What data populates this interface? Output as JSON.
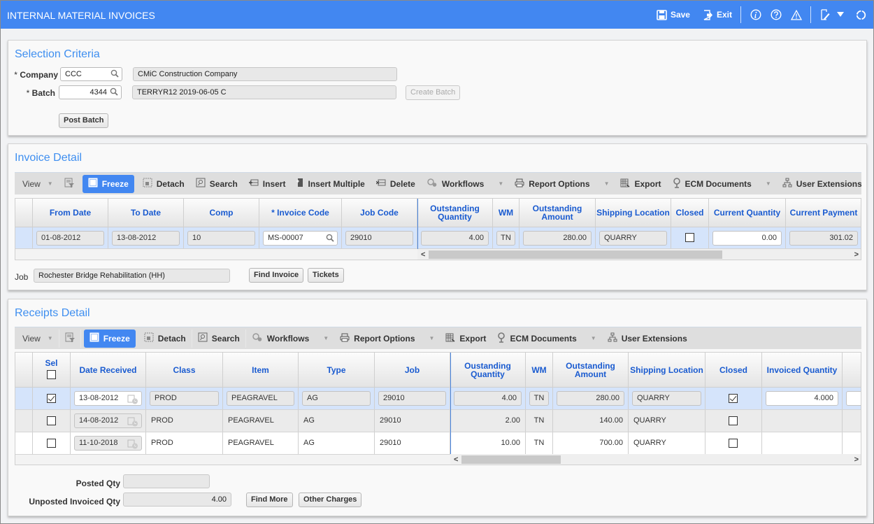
{
  "app": {
    "title": "INTERNAL MATERIAL INVOICES",
    "actions": {
      "save": "Save",
      "exit": "Exit"
    },
    "icons": [
      "save-icon",
      "exit-icon",
      "info-icon",
      "help-icon",
      "warning-icon",
      "edit-icon",
      "dropdown-icon",
      "refresh-icon"
    ],
    "accent": "#4287f1"
  },
  "selection": {
    "title": "Selection Criteria",
    "company_label": "Company",
    "company_value": "CCC",
    "company_name": "CMiC Construction Company",
    "batch_label": "Batch",
    "batch_value": "4344",
    "batch_desc": "TERRYR12 2019-06-05 C",
    "create_batch": "Create Batch",
    "post_batch": "Post Batch",
    "required_mark": "*"
  },
  "invoice": {
    "title": "Invoice Detail",
    "toolbar": {
      "view": "View",
      "freeze": "Freeze",
      "detach": "Detach",
      "search": "Search",
      "insert": "Insert",
      "insert_multiple": "Insert Multiple",
      "delete": "Delete",
      "workflows": "Workflows",
      "report_options": "Report Options",
      "export": "Export",
      "ecm": "ECM Documents",
      "user_ext": "User Extensions"
    },
    "columns": [
      "From Date",
      "To Date",
      "Comp",
      "* Invoice Code",
      "Job Code",
      "Outstanding Quantity",
      "WM",
      "Outstanding Amount",
      "Shipping Location",
      "Closed",
      "Current Quantity",
      "Current Payment"
    ],
    "row": {
      "from_date": "01-08-2012",
      "to_date": "13-08-2012",
      "comp": "10",
      "invoice_code": "MS-00007",
      "job_code": "29010",
      "out_qty": "4.00",
      "wm": "TN",
      "out_amt": "280.00",
      "ship_loc": "QUARRY",
      "closed": false,
      "cur_qty": "0.00",
      "cur_pay": "301.02"
    },
    "job_label": "Job",
    "job_value": "Rochester Bridge Rehabilitation (HH)",
    "find_invoice": "Find Invoice",
    "tickets": "Tickets"
  },
  "receipts": {
    "title": "Receipts Detail",
    "toolbar": {
      "view": "View",
      "freeze": "Freeze",
      "detach": "Detach",
      "search": "Search",
      "workflows": "Workflows",
      "report_options": "Report Options",
      "export": "Export",
      "ecm": "ECM Documents",
      "user_ext": "User Extensions"
    },
    "columns": [
      "Sel",
      "Date Received",
      "Class",
      "Item",
      "Type",
      "Job",
      "Oustanding Quantity",
      "WM",
      "Outstanding Amount",
      "Shipping Location",
      "Closed",
      "Invoiced Quantity"
    ],
    "rows": [
      {
        "sel": true,
        "date": "13-08-2012",
        "class": "PROD",
        "item": "PEAGRAVEL",
        "type": "AG",
        "job": "29010",
        "out_qty": "4.00",
        "wm": "TN",
        "out_amt": "280.00",
        "ship_loc": "QUARRY",
        "closed": true,
        "inv_qty": "4.000"
      },
      {
        "sel": false,
        "date": "14-08-2012",
        "class": "PROD",
        "item": "PEAGRAVEL",
        "type": "AG",
        "job": "29010",
        "out_qty": "2.00",
        "wm": "TN",
        "out_amt": "140.00",
        "ship_loc": "QUARRY",
        "closed": false,
        "inv_qty": ""
      },
      {
        "sel": false,
        "date": "11-10-2018",
        "class": "PROD",
        "item": "PEAGRAVEL",
        "type": "AG",
        "job": "29010",
        "out_qty": "10.00",
        "wm": "TN",
        "out_amt": "700.00",
        "ship_loc": "QUARRY",
        "closed": false,
        "inv_qty": ""
      }
    ],
    "posted_qty_label": "Posted Qty",
    "posted_qty_value": "",
    "unposted_label": "Unposted Invoiced Qty",
    "unposted_value": "4.00",
    "find_more": "Find More",
    "other_charges": "Other Charges"
  }
}
